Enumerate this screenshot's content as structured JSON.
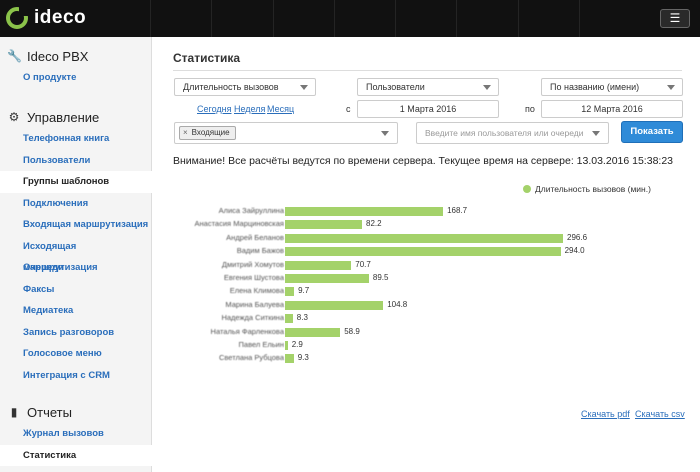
{
  "app": {
    "logo_text": "ideco",
    "menu_icon": "hamburger-icon",
    "accent_color": "#8bc34a",
    "bar_color": "#a4d26a",
    "button_color": "#2f8bd8"
  },
  "sidebar": {
    "sections": [
      {
        "title": "Ideco PBX",
        "icon": "wrench-icon",
        "items": [
          "О продукте"
        ]
      },
      {
        "title": "Управление",
        "icon": "gear-icon",
        "items": [
          "Телефонная книга",
          "Пользователи",
          "Группы шаблонов",
          "Подключения",
          "Входящая маршрутизация",
          "Исходящая маршрутизация",
          "Очереди",
          "Факсы",
          "Медиатека",
          "Запись разговоров",
          "Голосовое меню",
          "Интеграция с CRM"
        ]
      },
      {
        "title": "Отчеты",
        "icon": "bar-chart-icon",
        "items": [
          "Журнал вызовов",
          "Статистика"
        ]
      }
    ],
    "active_item": "Статистика"
  },
  "page": {
    "title": "Статистика",
    "filters": {
      "metric": "Длительность вызовов",
      "group_by": "Пользователи",
      "sort": "По названию (имени)",
      "quick_today": "Сегодня",
      "quick_week": "Неделя",
      "quick_month": "Месяц",
      "from_label": "с",
      "from_date": "1 Марта 2016",
      "to_label": "по",
      "to_date": "12 Марта 2016",
      "direction_tag": "Входящие",
      "tag_remove": "×",
      "user_placeholder": "Введите имя пользователя или очереди",
      "show_button": "Показать"
    },
    "notice": "Внимание! Все расчёты ведутся по времени сервера. Текущее время на сервере: 13.03.2016 15:38:23",
    "downloads": {
      "pdf": "Скачать pdf",
      "csv": "Скачать csv"
    }
  },
  "chart_data": {
    "type": "bar",
    "orientation": "horizontal",
    "legend": "Длительность вызовов (мин.)",
    "legend_position": "top-right",
    "categories": [
      "Алиса Зайруллина",
      "Анастасия Марциновская",
      "Андрей Беланов",
      "Вадим Бажов",
      "Дмитрий Хомутов",
      "Евгения Шустова",
      "Елена Климова",
      "Марина Балуева",
      "Надежда Ситкина",
      "Наталья Фарленкова",
      "Павел Ельин",
      "Светлана Рубцова"
    ],
    "values": [
      168.7,
      82.2,
      296.6,
      294.0,
      70.7,
      89.5,
      9.7,
      104.8,
      8.3,
      58.9,
      2.9,
      9.3
    ],
    "value_labels": [
      "168.7",
      "82.2",
      "296.6",
      "294.0",
      "70.7",
      "89.5",
      "9.7",
      "104.8",
      "8.3",
      "58.9",
      "2.9",
      "9.3"
    ],
    "xlim": [
      0,
      296.6
    ]
  }
}
